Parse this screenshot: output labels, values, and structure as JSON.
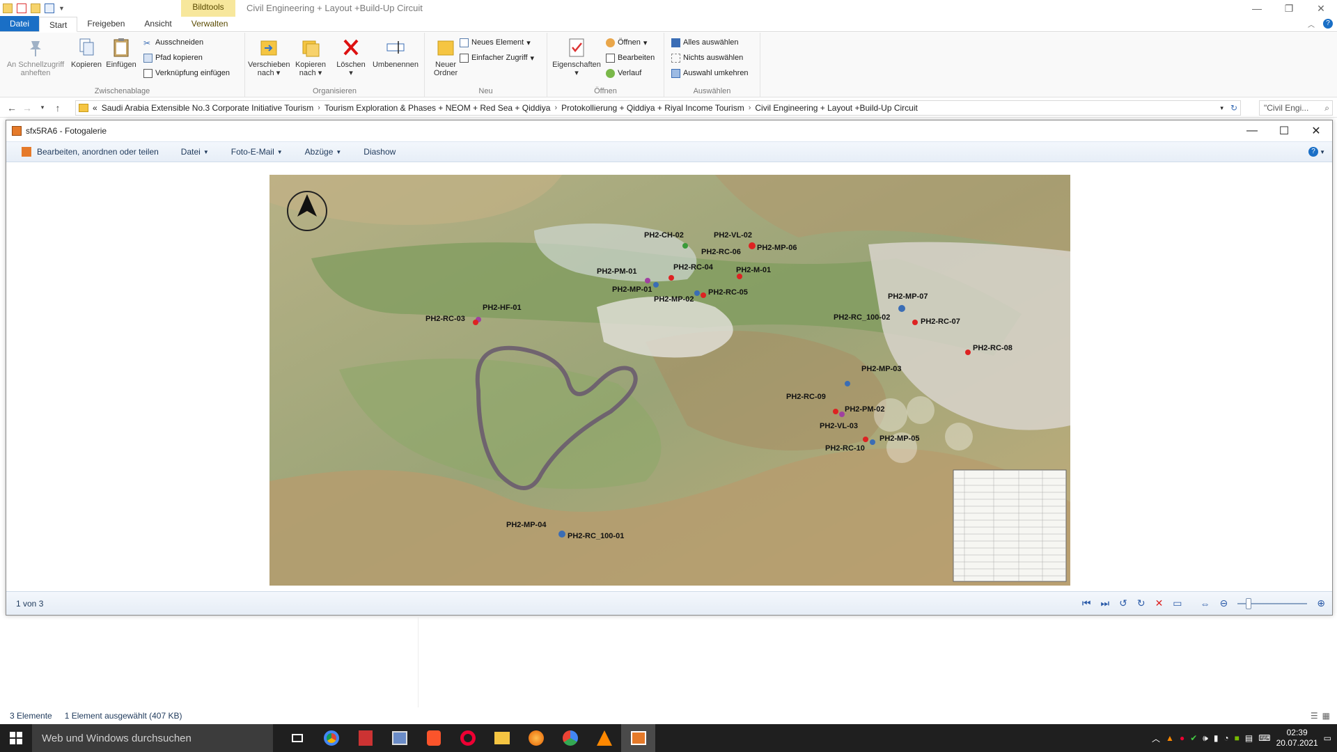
{
  "qat": {
    "context_tab": "Bildtools",
    "window_title": "Civil Engineering + Layout +Build-Up Circuit"
  },
  "tabs": [
    {
      "label": "Datei"
    },
    {
      "label": "Start"
    },
    {
      "label": "Freigeben"
    },
    {
      "label": "Ansicht"
    },
    {
      "label": "Verwalten"
    }
  ],
  "ribbon": {
    "clipboard": {
      "pin": "An Schnellzugriff anheften",
      "copy": "Kopieren",
      "paste": "Einfügen",
      "cut": "Ausschneiden",
      "copy_path": "Pfad kopieren",
      "paste_shortcut": "Verknüpfung einfügen",
      "caption": "Zwischenablage"
    },
    "organize": {
      "move": "Verschieben nach",
      "copyto": "Kopieren nach",
      "delete": "Löschen",
      "rename": "Umbenennen",
      "caption": "Organisieren"
    },
    "new": {
      "new_folder": "Neuer Ordner",
      "new_item": "Neues Element",
      "easy_access": "Einfacher Zugriff",
      "caption": "Neu"
    },
    "open": {
      "properties": "Eigenschaften",
      "open": "Öffnen",
      "edit": "Bearbeiten",
      "history": "Verlauf",
      "caption": "Öffnen"
    },
    "select": {
      "all": "Alles auswählen",
      "none": "Nichts auswählen",
      "invert": "Auswahl umkehren",
      "caption": "Auswählen"
    }
  },
  "address": {
    "crumbs": [
      "«",
      "Saudi Arabia Extensible No.3 Corporate Initiative Tourism",
      "Tourism Exploration & Phases + NEOM + Red Sea + Qiddiya",
      "Protokollierung + Qiddiya + Riyal Income Tourism",
      "Civil Engineering + Layout +Build-Up Circuit"
    ],
    "search_placeholder": "\"Civil Engi..."
  },
  "gallery": {
    "title": "sfx5RA6 - Fotogalerie",
    "menu": [
      "Bearbeiten, anordnen oder teilen",
      "Datei",
      "Foto-E-Mail",
      "Abzüge",
      "Diashow"
    ],
    "counter": "1 von 3"
  },
  "map_labels": [
    {
      "text": "PH2-CH-02"
    },
    {
      "text": "PH2-VL-02"
    },
    {
      "text": "PH2-RC-06"
    },
    {
      "text": "PH2-MP-06"
    },
    {
      "text": "PH2-PM-01"
    },
    {
      "text": "PH2-RC-04"
    },
    {
      "text": "PH2-M-01"
    },
    {
      "text": "PH2-MP-01"
    },
    {
      "text": "PH2-MP-02"
    },
    {
      "text": "PH2-RC-05"
    },
    {
      "text": "PH2-HF-01"
    },
    {
      "text": "PH2-RC-03"
    },
    {
      "text": "PH2-MP-07"
    },
    {
      "text": "PH2-RC_100-02"
    },
    {
      "text": "PH2-RC-07"
    },
    {
      "text": "PH2-RC-08"
    },
    {
      "text": "PH2-MP-03"
    },
    {
      "text": "PH2-RC-09"
    },
    {
      "text": "PH2-PM-02"
    },
    {
      "text": "PH2-VL-03"
    },
    {
      "text": "PH2-MP-05"
    },
    {
      "text": "PH2-RC-10"
    },
    {
      "text": "PH2-MP-04"
    },
    {
      "text": "PH2-RC_100-01"
    }
  ],
  "explorer_status": {
    "items": "3 Elemente",
    "selected": "1 Element ausgewählt (407 KB)"
  },
  "taskbar": {
    "search": "Web und Windows durchsuchen",
    "time": "02:39",
    "date": "20.07.2021"
  }
}
